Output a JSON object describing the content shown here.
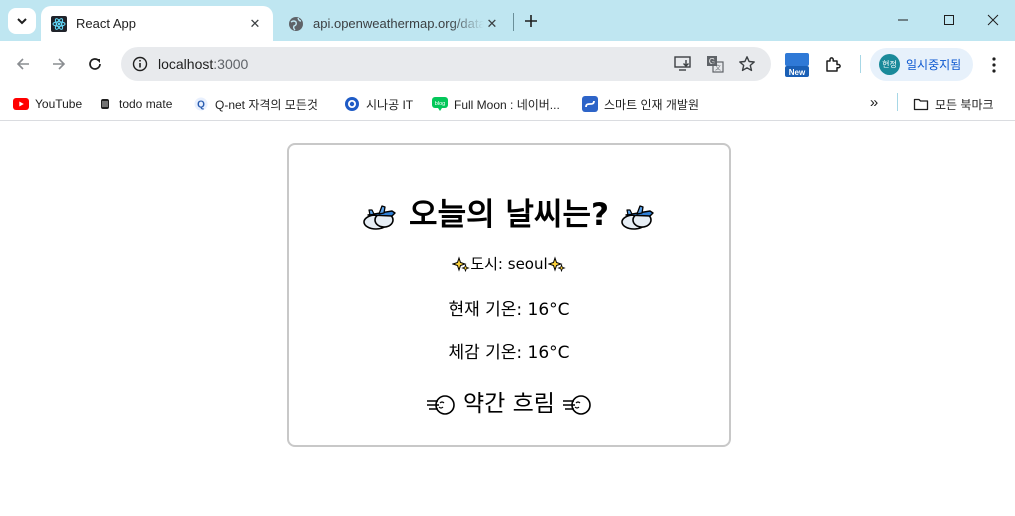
{
  "browser": {
    "tabs": [
      {
        "title": "React App",
        "active": true
      },
      {
        "title": "api.openweathermap.org/data",
        "active": false
      }
    ],
    "address": {
      "host": "localhost",
      "port": ":3000"
    },
    "profile_label": "일시중지됨",
    "profile_avatar_text": "현정",
    "extension_badge": "New",
    "bookmarks": [
      {
        "label": "YouTube",
        "icon": "youtube-icon"
      },
      {
        "label": "todo mate",
        "icon": "todo-mate-icon"
      },
      {
        "label": "Q-net 자격의 모든것",
        "icon": "qnet-icon"
      },
      {
        "label": "시나공 IT",
        "icon": "sinagong-icon"
      },
      {
        "label": "Full Moon : 네이버...",
        "icon": "naver-blog-icon"
      },
      {
        "label": "스마트 인재 개발원",
        "icon": "smart-academy-icon"
      }
    ],
    "all_bookmarks_label": "모든 북마크"
  },
  "weather": {
    "title": "오늘의 날씨는?",
    "city_prefix": "도시: ",
    "city": "seoul",
    "current_temp_label": "현재 기온: ",
    "current_temp": "16°C",
    "feels_like_label": "체감 기온: ",
    "feels_like": "16°C",
    "description": "약간 흐림"
  },
  "colors": {
    "tabstrip": "#bfe6f1",
    "omnibox": "#e8eaed",
    "card_border": "#c8c8c8",
    "accent": "#0b57d0"
  }
}
